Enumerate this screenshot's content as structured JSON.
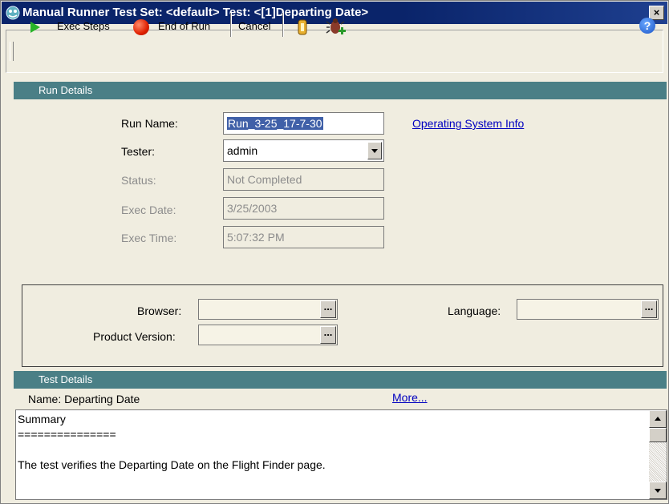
{
  "window": {
    "title": "Manual Runner  Test Set: <default>  Test: <[1]Departing Date>",
    "close_label": "×"
  },
  "toolbar": {
    "exec_steps_label": "Exec Steps",
    "end_of_run_label": "End of Run",
    "cancel_label": "Cancel",
    "help_label": "?",
    "icons": [
      "play-icon",
      "stop-icon",
      "attachment-icon",
      "add-defect-icon",
      "help-icon"
    ],
    "colors": {
      "play": "#28b428",
      "stop": "#e02000"
    }
  },
  "run_details": {
    "header": "Run Details",
    "run_name_label": "Run Name:",
    "run_name_value": "Run_3-25_17-7-30",
    "tester_label": "Tester:",
    "tester_value": "admin",
    "status_label": "Status:",
    "status_value": "Not Completed",
    "exec_date_label": "Exec Date:",
    "exec_date_value": "3/25/2003",
    "exec_time_label": "Exec Time:",
    "exec_time_value": "5:07:32 PM",
    "os_info_link": "Operating System Info"
  },
  "environment": {
    "browser_label": "Browser:",
    "browser_value": "",
    "language_label": "Language:",
    "language_value": "",
    "product_version_label": "Product Version:",
    "product_version_value": "",
    "ellipsis": "..."
  },
  "test_details": {
    "header": "Test Details",
    "name_text": "Name: Departing Date",
    "more_link": "More...",
    "summary_lines": [
      "Summary",
      "===============",
      "",
      "The test verifies the Departing Date on the Flight Finder page."
    ]
  },
  "colors": {
    "section_header": "#4a7f86",
    "title_bar": "#0a246a",
    "link": "#0000c0"
  }
}
